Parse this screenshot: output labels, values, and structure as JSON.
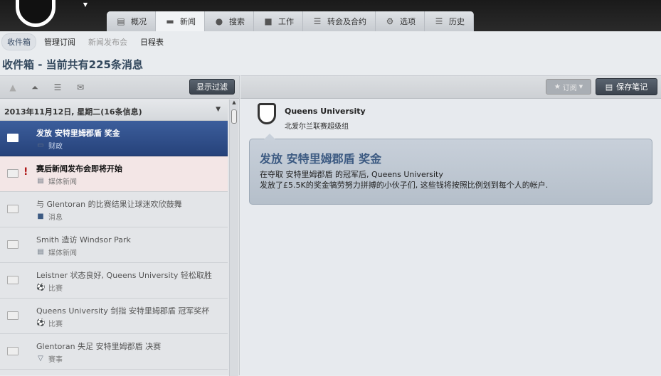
{
  "tabs": [
    {
      "label": "概况",
      "icon": "profile-icon"
    },
    {
      "label": "新闻",
      "icon": "inbox-tray-icon"
    },
    {
      "label": "搜索",
      "icon": "scout-icon"
    },
    {
      "label": "工作",
      "icon": "briefcase-icon"
    },
    {
      "label": "转会及合约",
      "icon": "document-icon"
    },
    {
      "label": "选项",
      "icon": "gear-icon"
    },
    {
      "label": "历史",
      "icon": "scroll-icon"
    }
  ],
  "subnav": [
    "收件箱",
    "管理订阅",
    "新闻发布会",
    "日程表"
  ],
  "page_title": "收件箱 - 当前共有225条消息",
  "left_toolbar": {
    "filter_button": "显示过滤"
  },
  "date_header": "2013年11月12日, 星期二(16条信息)",
  "messages": [
    {
      "title": "发放 安特里姆郡盾 奖金",
      "category": "财政"
    },
    {
      "title": "赛后新闻发布会即将开始",
      "category": "媒体新闻"
    },
    {
      "title": "与 Glentoran 的比赛结果让球迷欢欣鼓舞",
      "category": "消息"
    },
    {
      "title": "Smith 造访 Windsor Park",
      "category": "媒体新闻"
    },
    {
      "title": "Leistner 状态良好, Queens University 轻松取胜",
      "category": "比赛"
    },
    {
      "title": "Queens University 剑指 安特里姆郡盾 冠军奖杯",
      "category": "比赛"
    },
    {
      "title": "Glentoran 失足 安特里姆郡盾 决赛",
      "category": "赛事"
    }
  ],
  "right_toolbar": {
    "subscribe": "订阅",
    "save_note": "保存笔记"
  },
  "detail": {
    "club": "Queens University",
    "league": "北爱尔兰联赛超级组",
    "title": "发放 安特里姆郡盾 奖金",
    "body_line1": "在夺取 安特里姆郡盾 的冠军后, Queens University",
    "body_line2": "发放了£5.5K的奖金犒劳努力拼搏的小伙子们, 这些钱将按照比例划到每个人的帐户."
  }
}
